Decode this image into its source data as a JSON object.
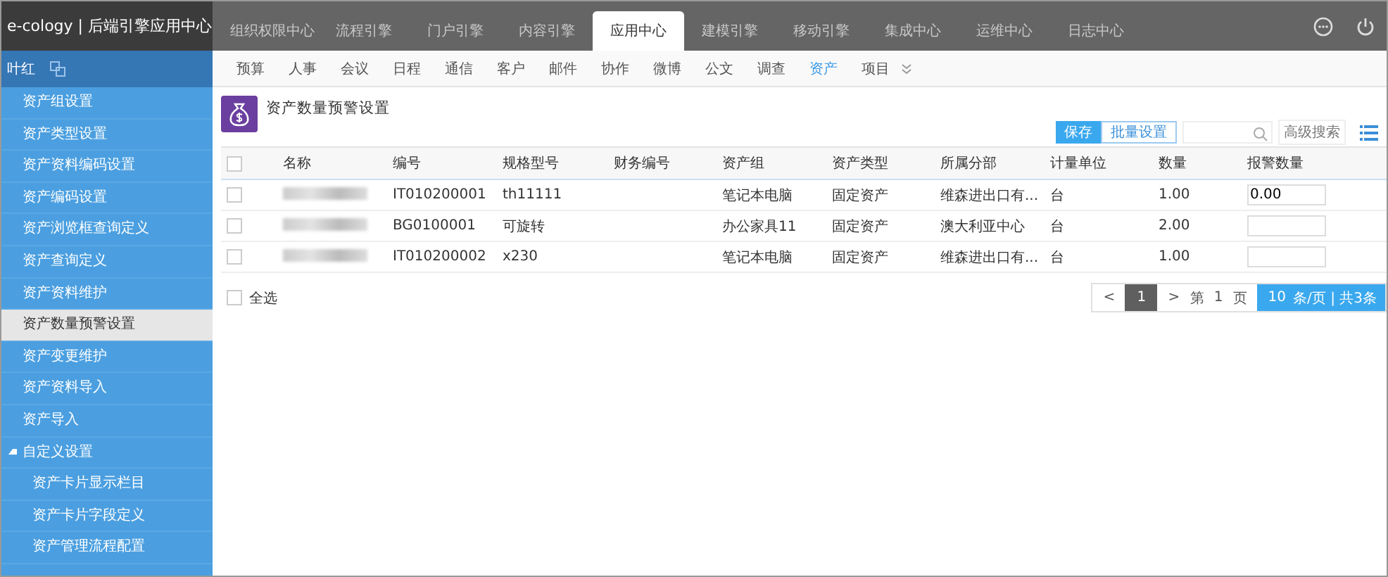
{
  "app_title": "e-cology | 后端引擎应用中心",
  "top_tabs": [
    {
      "label": "组织权限中心",
      "selected": false
    },
    {
      "label": "流程引擎",
      "selected": false
    },
    {
      "label": "门户引擎",
      "selected": false
    },
    {
      "label": "内容引擎",
      "selected": false
    },
    {
      "label": "应用中心",
      "selected": true
    },
    {
      "label": "建模引擎",
      "selected": false
    },
    {
      "label": "移动引擎",
      "selected": false
    },
    {
      "label": "集成中心",
      "selected": false
    },
    {
      "label": "运维中心",
      "selected": false
    },
    {
      "label": "日志中心",
      "selected": false
    }
  ],
  "user": "叶红",
  "sub_tabs": [
    {
      "label": "预算",
      "selected": false
    },
    {
      "label": "人事",
      "selected": false
    },
    {
      "label": "会议",
      "selected": false
    },
    {
      "label": "日程",
      "selected": false
    },
    {
      "label": "通信",
      "selected": false
    },
    {
      "label": "客户",
      "selected": false
    },
    {
      "label": "邮件",
      "selected": false
    },
    {
      "label": "协作",
      "selected": false
    },
    {
      "label": "微博",
      "selected": false
    },
    {
      "label": "公文",
      "selected": false
    },
    {
      "label": "调查",
      "selected": false
    },
    {
      "label": "资产",
      "selected": true
    },
    {
      "label": "项目",
      "selected": false
    }
  ],
  "sidebar": {
    "items": [
      {
        "label": "资产组设置",
        "selected": false
      },
      {
        "label": "资产类型设置",
        "selected": false
      },
      {
        "label": "资产资料编码设置",
        "selected": false
      },
      {
        "label": "资产编码设置",
        "selected": false
      },
      {
        "label": "资产浏览框查询定义",
        "selected": false
      },
      {
        "label": "资产查询定义",
        "selected": false
      },
      {
        "label": "资产资料维护",
        "selected": false
      },
      {
        "label": "资产数量预警设置",
        "selected": true
      },
      {
        "label": "资产变更维护",
        "selected": false
      },
      {
        "label": "资产资料导入",
        "selected": false
      },
      {
        "label": "资产导入",
        "selected": false
      },
      {
        "label": "自定义设置",
        "selected": false,
        "expanded": true,
        "children": [
          {
            "label": "资产卡片显示栏目",
            "selected": false
          },
          {
            "label": "资产卡片字段定义",
            "selected": false
          },
          {
            "label": "资产管理流程配置",
            "selected": false
          }
        ]
      }
    ]
  },
  "page_title": "资产数量预警设置",
  "toolbar": {
    "save": "保存",
    "batch": "批量设置",
    "advanced_search": "高级搜索"
  },
  "table": {
    "all_checked": false,
    "columns": [
      "名称",
      "编号",
      "规格型号",
      "财务编号",
      "资产组",
      "资产类型",
      "所属分部",
      "计量单位",
      "数量",
      "报警数量"
    ],
    "rows": [
      {
        "checked": false,
        "code": "IT010200001",
        "model": "th11111",
        "finance_no": "",
        "group": "笔记本电脑",
        "type": "固定资产",
        "branch": "维森进出口有...",
        "unit": "台",
        "quantity": "1.00",
        "alarm": "0.00"
      },
      {
        "checked": false,
        "code": "BG0100001",
        "model": "可旋转",
        "finance_no": "",
        "group": "办公家具11",
        "type": "固定资产",
        "branch": "澳大利亚中心",
        "unit": "台",
        "quantity": "2.00",
        "alarm": ""
      },
      {
        "checked": false,
        "code": "IT010200002",
        "model": "x230",
        "finance_no": "",
        "group": "笔记本电脑",
        "type": "固定资产",
        "branch": "维森进出口有...",
        "unit": "台",
        "quantity": "1.00",
        "alarm": ""
      }
    ]
  },
  "select_all": {
    "label": "全选",
    "checked": false
  },
  "pagination": {
    "prev": "<",
    "pages": [
      {
        "label": "1",
        "selected": true
      }
    ],
    "next": ">",
    "page_prefix": "第",
    "current": "1",
    "page_suffix": "页",
    "per_page": "10",
    "per_page_suffix": "条/页 | 共3条"
  }
}
